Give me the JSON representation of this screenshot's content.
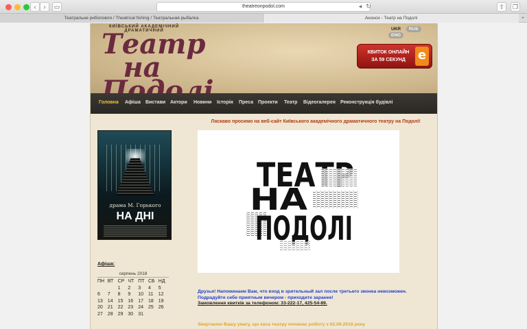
{
  "browser": {
    "url": "theatreonpodol.com",
    "tabs": [
      {
        "label": "Театральне рибоповля / Theatrical fishing / Театральная рыбалка"
      },
      {
        "label": "Анонси - Театр на Подолі"
      }
    ],
    "add_tab": "+"
  },
  "header": {
    "logo_top": "КИЇВСЬКИЙ АКАДЕМІЧНИЙ ДРАМАТИЧНИЙ",
    "logo_text": "Театр на Подолі",
    "languages": [
      {
        "label": "UKR"
      },
      {
        "label": "RUS"
      },
      {
        "label": "ENG"
      }
    ],
    "ticket": {
      "line1": "КВИТОК ОНЛАЙН",
      "line2": "ЗА 59 СЕКУНД",
      "badge": "e"
    }
  },
  "menu": {
    "items": [
      {
        "label": "Головна"
      },
      {
        "label": "Афіша"
      },
      {
        "label": "Вистави"
      },
      {
        "label": "Актори"
      },
      {
        "label": "Новини"
      },
      {
        "label": "Історія"
      },
      {
        "label": "Преса"
      },
      {
        "label": "Проекти"
      },
      {
        "label": "Театр"
      },
      {
        "label": "Відеогалерея"
      },
      {
        "label": "Реконструкція будівлі"
      }
    ]
  },
  "main": {
    "welcome": "Ласкаво просимо на веб-сайт Київського академічного драматичного театру на Подолі!",
    "poster_drama": "драма М. Горького",
    "poster_title": "НА ДНІ",
    "poster2_lines": [
      "ТЕАТР",
      "НА",
      "ПОДОЛІ"
    ],
    "reminder_1": "Друзья! Напоминаем Вам, что вход в зрительный зал после третьего звонка невозможен.",
    "reminder_2": "Подрадуйте себе приятным вечером - приходите заранее!",
    "reminder_3": "Замовлення квитків за телефоном: 33-222-17, 425-54-89.",
    "bottom_note": "Звертаємо Вашу увагу, що каса театру починає роботу з 02.09.2018 року"
  },
  "sidebar": {
    "afisha_label": "Афіша:",
    "calendar": {
      "month": "серпень 2018",
      "weekdays": [
        "ПН",
        "ВТ",
        "СР",
        "ЧТ",
        "ПТ",
        "СБ",
        "НД"
      ],
      "weeks": [
        [
          "",
          "",
          "1",
          "2",
          "3",
          "4",
          "5"
        ],
        [
          "6",
          "7",
          "8",
          "9",
          "10",
          "11",
          "12"
        ],
        [
          "13",
          "14",
          "15",
          "16",
          "17",
          "18",
          "19"
        ],
        [
          "20",
          "21",
          "22",
          "23",
          "24",
          "25",
          "26"
        ],
        [
          "27",
          "28",
          "29",
          "30",
          "31",
          "",
          ""
        ]
      ]
    }
  },
  "colors": {
    "menu_bg": "#2f2c28",
    "menu_active": "#f4c13d",
    "welcome": "#b13a16",
    "reminder_blue": "#1f3dd1",
    "note_orange": "#e3a42a",
    "logo": "#6b2a3f"
  }
}
